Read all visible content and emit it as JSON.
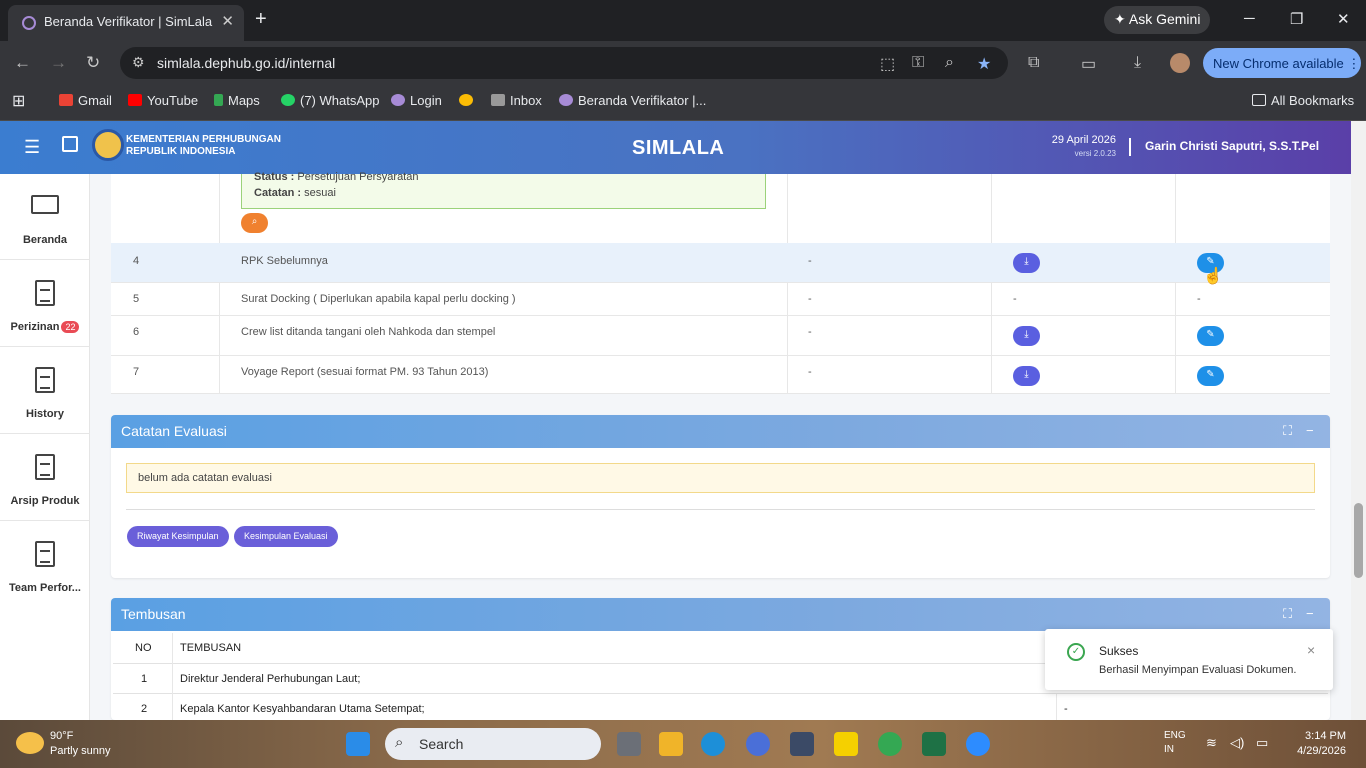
{
  "browser": {
    "tab_title": "Beranda Verifikator | SimLala",
    "ask_gemini": "Ask Gemini",
    "url": "simlala.dephub.go.id/internal",
    "new_chrome": "New Chrome available",
    "new_tab": "+",
    "close_tab": "✕"
  },
  "bookmarks": [
    {
      "label": "Gmail",
      "color": "#ea4335"
    },
    {
      "label": "YouTube",
      "color": "#ff0000"
    },
    {
      "label": "Maps",
      "color": "#34a853"
    },
    {
      "label": "(7) WhatsApp",
      "color": "#25d366"
    },
    {
      "label": "Login",
      "color": "#a78bd6"
    },
    {
      "label": "",
      "color": "#fbbc05"
    },
    {
      "label": "Inbox",
      "color": "#999999"
    },
    {
      "label": "Beranda Verifikator |...",
      "color": "#a78bd6"
    }
  ],
  "all_bookmarks": "All Bookmarks",
  "header": {
    "org_line1": "KEMENTERIAN PERHUBUNGAN",
    "org_line2": "REPUBLIK INDONESIA",
    "app": "SIMLALA",
    "date": "29 April 2026",
    "version": "versi 2.0.23",
    "user": "Garin Christi Saputri, S.S.T.Pel"
  },
  "sidebar": [
    {
      "label": "Beranda",
      "icon": "monitor-icon"
    },
    {
      "label": "Perizinan",
      "badge": "22",
      "icon": "document-icon"
    },
    {
      "label": "History",
      "icon": "document-icon"
    },
    {
      "label": "Arsip Produk",
      "icon": "document-icon"
    },
    {
      "label": "Team Perfor...",
      "icon": "document-icon"
    }
  ],
  "doc_table": {
    "status_label": "Status :",
    "status_value": "Persetujuan Persyaratan",
    "catatan_label": "Catatan :",
    "catatan_value": "sesuai",
    "rows": [
      {
        "no": "4",
        "name": "RPK Sebelumnya",
        "col3": "-"
      },
      {
        "no": "5",
        "name": "Surat Docking ( Diperlukan apabila kapal perlu docking )",
        "col3": "-",
        "col4": "-",
        "col5": "-"
      },
      {
        "no": "6",
        "name": "Crew list ditanda tangani oleh Nahkoda dan stempel",
        "col3": "-"
      },
      {
        "no": "7",
        "name": "Voyage Report (sesuai format PM. 93 Tahun 2013)",
        "col3": "-"
      }
    ]
  },
  "catatan_evaluasi": {
    "title": "Catatan Evaluasi",
    "note": "belum ada catatan evaluasi",
    "btn_riwayat": "Riwayat Kesimpulan",
    "btn_kesimpulan": "Kesimpulan Evaluasi"
  },
  "tembusan": {
    "title": "Tembusan",
    "col_no": "NO",
    "col_name": "TEMBUSAN",
    "rows": [
      {
        "no": "1",
        "name": "Direktur Jenderal Perhubungan Laut;",
        "extra": ""
      },
      {
        "no": "2",
        "name": "Kepala Kantor Kesyahbandaran Utama Setempat;",
        "extra": "-"
      }
    ]
  },
  "toast": {
    "title": "Sukses",
    "message": "Berhasil Menyimpan Evaluasi Dokumen.",
    "close": "×"
  },
  "taskbar": {
    "temp": "90°F",
    "weather": "Partly sunny",
    "search": "Search",
    "lang1": "ENG",
    "lang2": "IN",
    "time": "3:14 PM",
    "date": "4/29/2026"
  }
}
